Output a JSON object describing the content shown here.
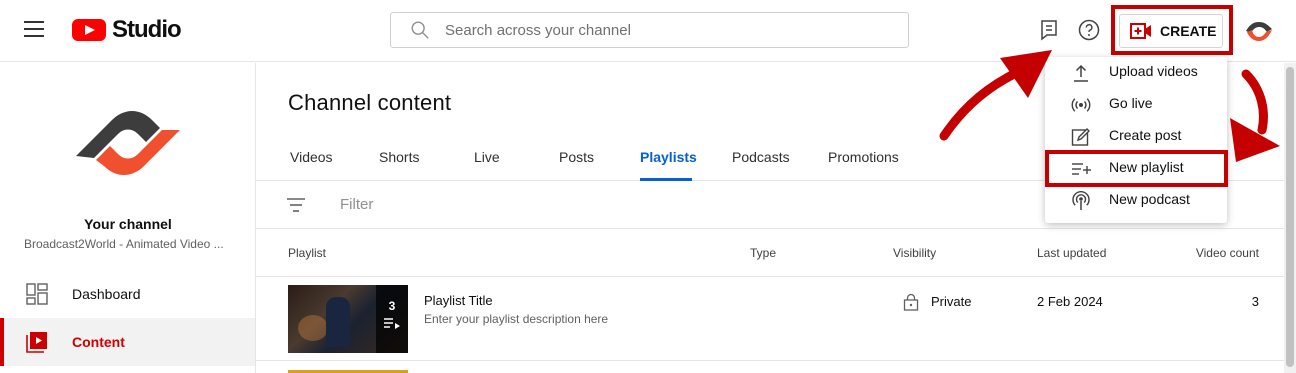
{
  "header": {
    "app_name": "Studio",
    "search_placeholder": "Search across your channel",
    "create_label": "CREATE"
  },
  "create_menu": {
    "items": [
      {
        "label": "Upload videos",
        "icon": "upload-icon"
      },
      {
        "label": "Go live",
        "icon": "live-broadcast-icon"
      },
      {
        "label": "Create post",
        "icon": "edit-post-icon"
      },
      {
        "label": "New playlist",
        "icon": "playlist-add-icon"
      },
      {
        "label": "New podcast",
        "icon": "podcast-icon"
      }
    ],
    "highlighted": "New playlist"
  },
  "sidebar": {
    "your_channel": "Your channel",
    "channel_name": "Broadcast2World - Animated Video ...",
    "items": [
      {
        "label": "Dashboard",
        "icon": "dashboard-icon"
      },
      {
        "label": "Content",
        "icon": "content-icon",
        "active": true
      }
    ]
  },
  "main": {
    "title": "Channel content",
    "tabs": [
      "Videos",
      "Shorts",
      "Live",
      "Posts",
      "Playlists",
      "Podcasts",
      "Promotions"
    ],
    "active_tab": "Playlists",
    "filter_placeholder": "Filter",
    "columns": [
      "Playlist",
      "Type",
      "Visibility",
      "Last updated",
      "Video count"
    ],
    "rows": [
      {
        "title": "Playlist Title",
        "description": "Enter your playlist description here",
        "type": "",
        "visibility": "Private",
        "last_updated": "2 Feb 2024",
        "video_count": "3",
        "thumb_count": "3"
      }
    ]
  },
  "colors": {
    "brand_red": "#ff0000",
    "annotation_red": "#c40000",
    "active_blue": "#065fd4",
    "logo_dark": "#3d3d3d",
    "logo_orange": "#f0502d"
  }
}
